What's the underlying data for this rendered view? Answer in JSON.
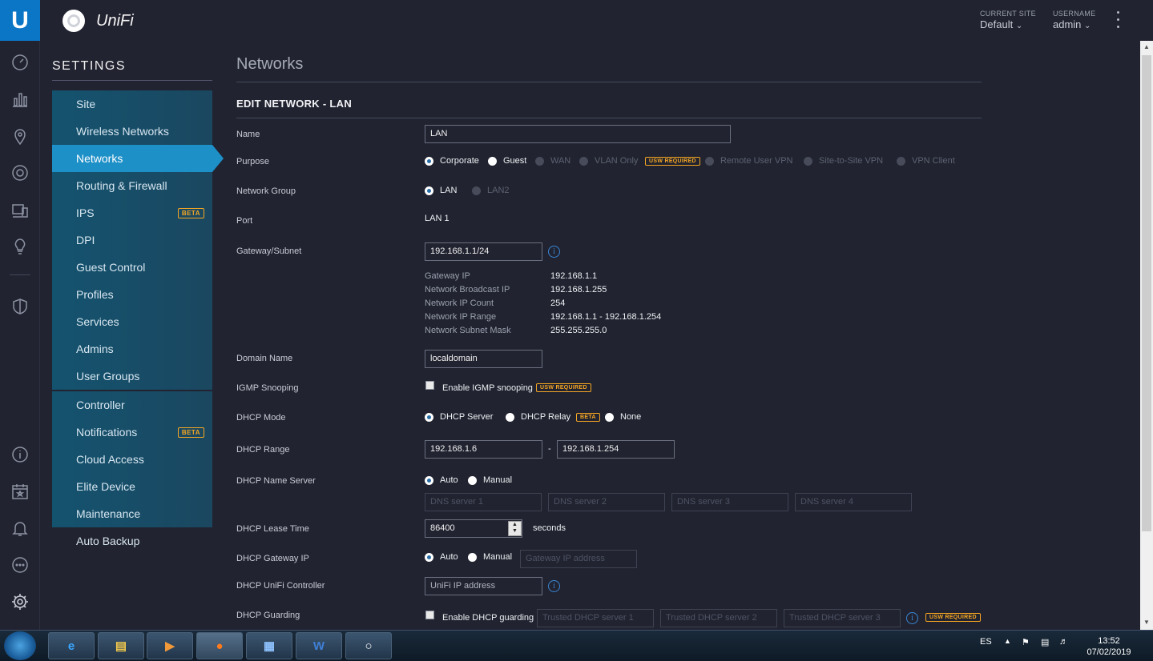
{
  "header": {
    "brand": "UniFi",
    "logo_letter": "U",
    "site_label": "CURRENT SITE",
    "site_value": "Default",
    "user_label": "USERNAME",
    "user_value": "admin"
  },
  "settings": {
    "title": "SETTINGS",
    "items": [
      {
        "label": "Site"
      },
      {
        "label": "Wireless Networks"
      },
      {
        "label": "Networks",
        "active": true
      },
      {
        "label": "Routing & Firewall"
      },
      {
        "label": "IPS",
        "badge": "BETA"
      },
      {
        "label": "DPI"
      },
      {
        "label": "Guest Control"
      },
      {
        "label": "Profiles"
      },
      {
        "label": "Services"
      },
      {
        "label": "Admins"
      },
      {
        "label": "User Groups"
      },
      {
        "label": "Controller"
      },
      {
        "label": "Notifications",
        "badge": "BETA"
      },
      {
        "label": "Cloud Access"
      },
      {
        "label": "Elite Device"
      },
      {
        "label": "Maintenance"
      },
      {
        "label": "Auto Backup"
      }
    ]
  },
  "page": {
    "title": "Networks",
    "section": "EDIT NETWORK - LAN"
  },
  "form": {
    "name_label": "Name",
    "name_value": "LAN",
    "purpose_label": "Purpose",
    "purpose_options": [
      "Corporate",
      "Guest",
      "WAN",
      "VLAN Only",
      "Remote User VPN",
      "Site-to-Site VPN",
      "VPN Client"
    ],
    "usw_required": "USW REQUIRED",
    "network_group_label": "Network Group",
    "network_group_options": [
      "LAN",
      "LAN2"
    ],
    "port_label": "Port",
    "port_value": "LAN 1",
    "gateway_label": "Gateway/Subnet",
    "gateway_value": "192.168.1.1/24",
    "info_glyph": "i",
    "details": [
      {
        "k": "Gateway IP",
        "v": "192.168.1.1"
      },
      {
        "k": "Network Broadcast IP",
        "v": "192.168.1.255"
      },
      {
        "k": "Network IP Count",
        "v": "254"
      },
      {
        "k": "Network IP Range",
        "v": "192.168.1.1 - 192.168.1.254"
      },
      {
        "k": "Network Subnet Mask",
        "v": "255.255.255.0"
      }
    ],
    "domain_label": "Domain Name",
    "domain_value": "localdomain",
    "igmp_label": "IGMP Snooping",
    "igmp_text": "Enable IGMP snooping",
    "dhcp_mode_label": "DHCP Mode",
    "dhcp_mode_options": [
      "DHCP Server",
      "DHCP Relay",
      "None"
    ],
    "beta": "BETA",
    "dhcp_range_label": "DHCP Range",
    "dhcp_range_start": "192.168.1.6",
    "dhcp_range_sep": "-",
    "dhcp_range_end": "192.168.1.254",
    "dns_label": "DHCP Name Server",
    "auto": "Auto",
    "manual": "Manual",
    "dns_placeholders": [
      "DNS server 1",
      "DNS server 2",
      "DNS server 3",
      "DNS server 4"
    ],
    "lease_label": "DHCP Lease Time",
    "lease_value": "86400",
    "lease_unit": "seconds",
    "gateway_ip_label": "DHCP Gateway IP",
    "gateway_ip_placeholder": "Gateway IP address",
    "controller_label": "DHCP UniFi Controller",
    "controller_placeholder": "UniFi IP address",
    "guarding_label": "DHCP Guarding",
    "guarding_text": "Enable DHCP guarding",
    "guarding_placeholders": [
      "Trusted DHCP server 1",
      "Trusted DHCP server 2",
      "Trusted DHCP server 3"
    ]
  },
  "taskbar": {
    "lang": "ES",
    "time": "13:52",
    "date": "07/02/2019",
    "apps": [
      "internet-explorer",
      "file-explorer",
      "media-player",
      "firefox",
      "control-panel",
      "word",
      "unifi"
    ]
  }
}
